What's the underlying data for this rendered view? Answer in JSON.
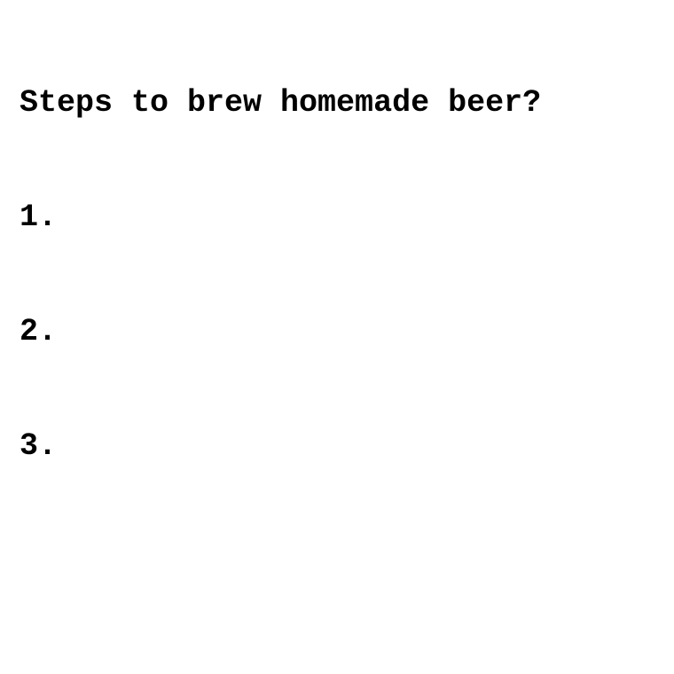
{
  "document": {
    "title": "Steps to brew homemade beer?",
    "items": [
      "1.",
      "2.",
      "3."
    ]
  }
}
